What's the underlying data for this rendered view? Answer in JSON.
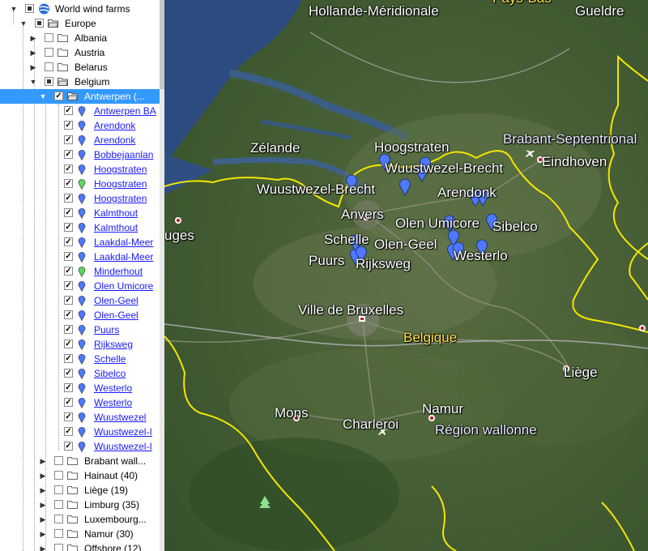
{
  "tree": {
    "root": "World wind farms",
    "europe": "Europe",
    "countries": [
      "Albania",
      "Austria",
      "Belarus",
      "Belgium"
    ],
    "selected": "Antwerpen (...",
    "sites": [
      {
        "label": "Antwerpen BA",
        "color": "blue"
      },
      {
        "label": "Arendonk",
        "color": "blue"
      },
      {
        "label": "Arendonk",
        "color": "blue"
      },
      {
        "label": "Bobbejaanlan",
        "color": "blue"
      },
      {
        "label": "Hoogstraten",
        "color": "blue"
      },
      {
        "label": "Hoogstraten",
        "color": "green"
      },
      {
        "label": "Hoogstraten",
        "color": "blue"
      },
      {
        "label": "Kalmthout",
        "color": "blue"
      },
      {
        "label": "Kalmthout",
        "color": "blue"
      },
      {
        "label": "Laakdal-Meer",
        "color": "blue"
      },
      {
        "label": "Laakdal-Meer",
        "color": "blue"
      },
      {
        "label": "Minderhout",
        "color": "green"
      },
      {
        "label": "Olen Umicore",
        "color": "blue"
      },
      {
        "label": "Olen-Geel",
        "color": "blue"
      },
      {
        "label": "Olen-Geel",
        "color": "blue"
      },
      {
        "label": "Puurs",
        "color": "blue"
      },
      {
        "label": "Rijksweg",
        "color": "blue"
      },
      {
        "label": "Schelle",
        "color": "blue"
      },
      {
        "label": "Sibelco",
        "color": "blue"
      },
      {
        "label": "Westerlo",
        "color": "blue"
      },
      {
        "label": "Westerlo",
        "color": "blue"
      },
      {
        "label": "Wuustwezel",
        "color": "blue"
      },
      {
        "label": "Wuustwezel-I",
        "color": "blue"
      },
      {
        "label": "Wuustwezel-I",
        "color": "blue"
      }
    ],
    "provinces": [
      "Brabant wall...",
      "Hainaut (40)",
      "Liège (19)",
      "Limburg (35)",
      "Luxembourg...",
      "Namur (30)",
      "Offshore (12)"
    ]
  },
  "map": {
    "places": {
      "hollande": "Hollande-Méridionale",
      "gueldre": "Gueldre",
      "zelande": "Zélande",
      "hoogstraten": "Hoogstraten",
      "wuustwezel_brecht_1": "Wuustwezel-Brecht",
      "wuustwezel_brecht_2": "Wuustwezel-Brecht",
      "brabant_sept": "Brabant-Septentrional",
      "eindhoven": "Eindhoven",
      "arendonk": "Arendonk",
      "anvers": "Anvers",
      "olen_umicore": "Olen Umicore",
      "sibelco": "Sibelco",
      "schelle": "Schelle",
      "olen_geel": "Olen-Geel",
      "puurs": "Puurs",
      "rijksweg": "Rijksweg",
      "westerlo": "Westerlo",
      "bruges": "uges",
      "bruxelles": "Ville de Bruxelles",
      "belgique": "Belgique",
      "liege": "Liège",
      "mons": "Mons",
      "namur": "Namur",
      "charleroi": "Charleroi",
      "wallonne": "Région wallonne",
      "top_partial": "Pays-Bas"
    },
    "colors": {
      "border": "#f2e600",
      "marker_blue": "#4d78ff",
      "marker_green": "#5dd65d"
    }
  }
}
